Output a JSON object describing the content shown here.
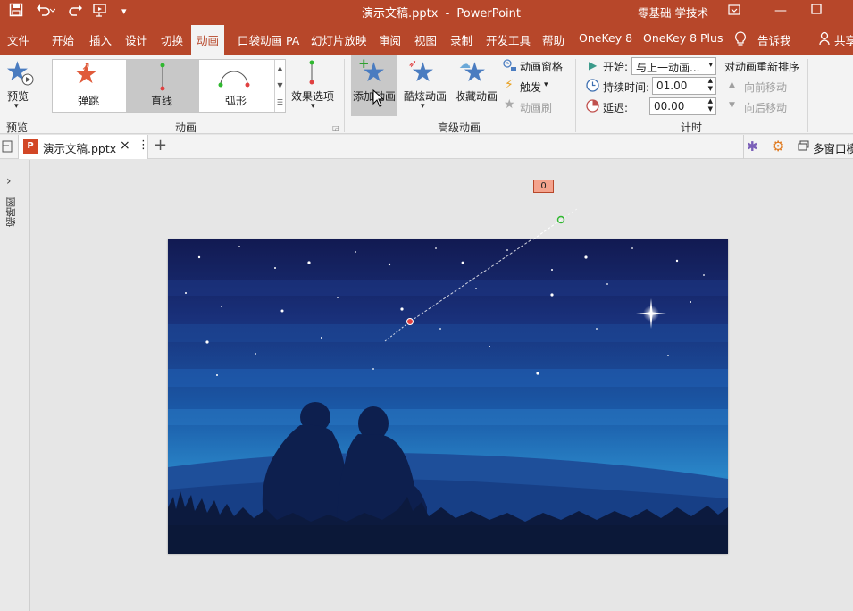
{
  "window": {
    "doc_title": "演示文稿.pptx",
    "separator": "-",
    "app_name": "PowerPoint",
    "user": "零基础 学技术"
  },
  "ribbon_tabs": [
    "文件",
    "开始",
    "插入",
    "设计",
    "切换",
    "动画",
    "口袋动画 PA",
    "幻灯片放映",
    "审阅",
    "视图",
    "录制",
    "开发工具",
    "帮助",
    "OneKey 8",
    "OneKey 8 Plus",
    "告诉我",
    "共享"
  ],
  "ribbon": {
    "preview": {
      "button": "预览",
      "group": "预览"
    },
    "animation": {
      "gallery": [
        "弹跳",
        "直线",
        "弧形"
      ],
      "selected": "直线",
      "effect_options": "效果选项",
      "group": "动画"
    },
    "advanced": {
      "add": "添加动画",
      "cool": "酷炫动画",
      "favorite": "收藏动画",
      "pane": "动画窗格",
      "trigger": "触发",
      "painter": "动画刷",
      "group": "高级动画"
    },
    "timing": {
      "start_label": "开始:",
      "start_value": "与上一动画...",
      "duration_label": "持续时间:",
      "duration_value": "01.00",
      "delay_label": "延迟:",
      "delay_value": "00.00",
      "reorder_title": "对动画重新排序",
      "move_earlier": "向前移动",
      "move_later": "向后移动",
      "group": "计时"
    }
  },
  "doc_tab": {
    "name": "演示文稿.pptx",
    "close": "×",
    "more": "⋮",
    "new": "+"
  },
  "multi_window": "多窗口模",
  "left_pane": {
    "toggle": "›",
    "label": "缩略图"
  },
  "slide": {
    "animation_tag": "0"
  },
  "colors": {
    "accent": "#b7472a",
    "star": "#4a7cc0",
    "bounce": "#e05a3a",
    "path_end": "#2fb82f",
    "path_start": "#e04040"
  }
}
